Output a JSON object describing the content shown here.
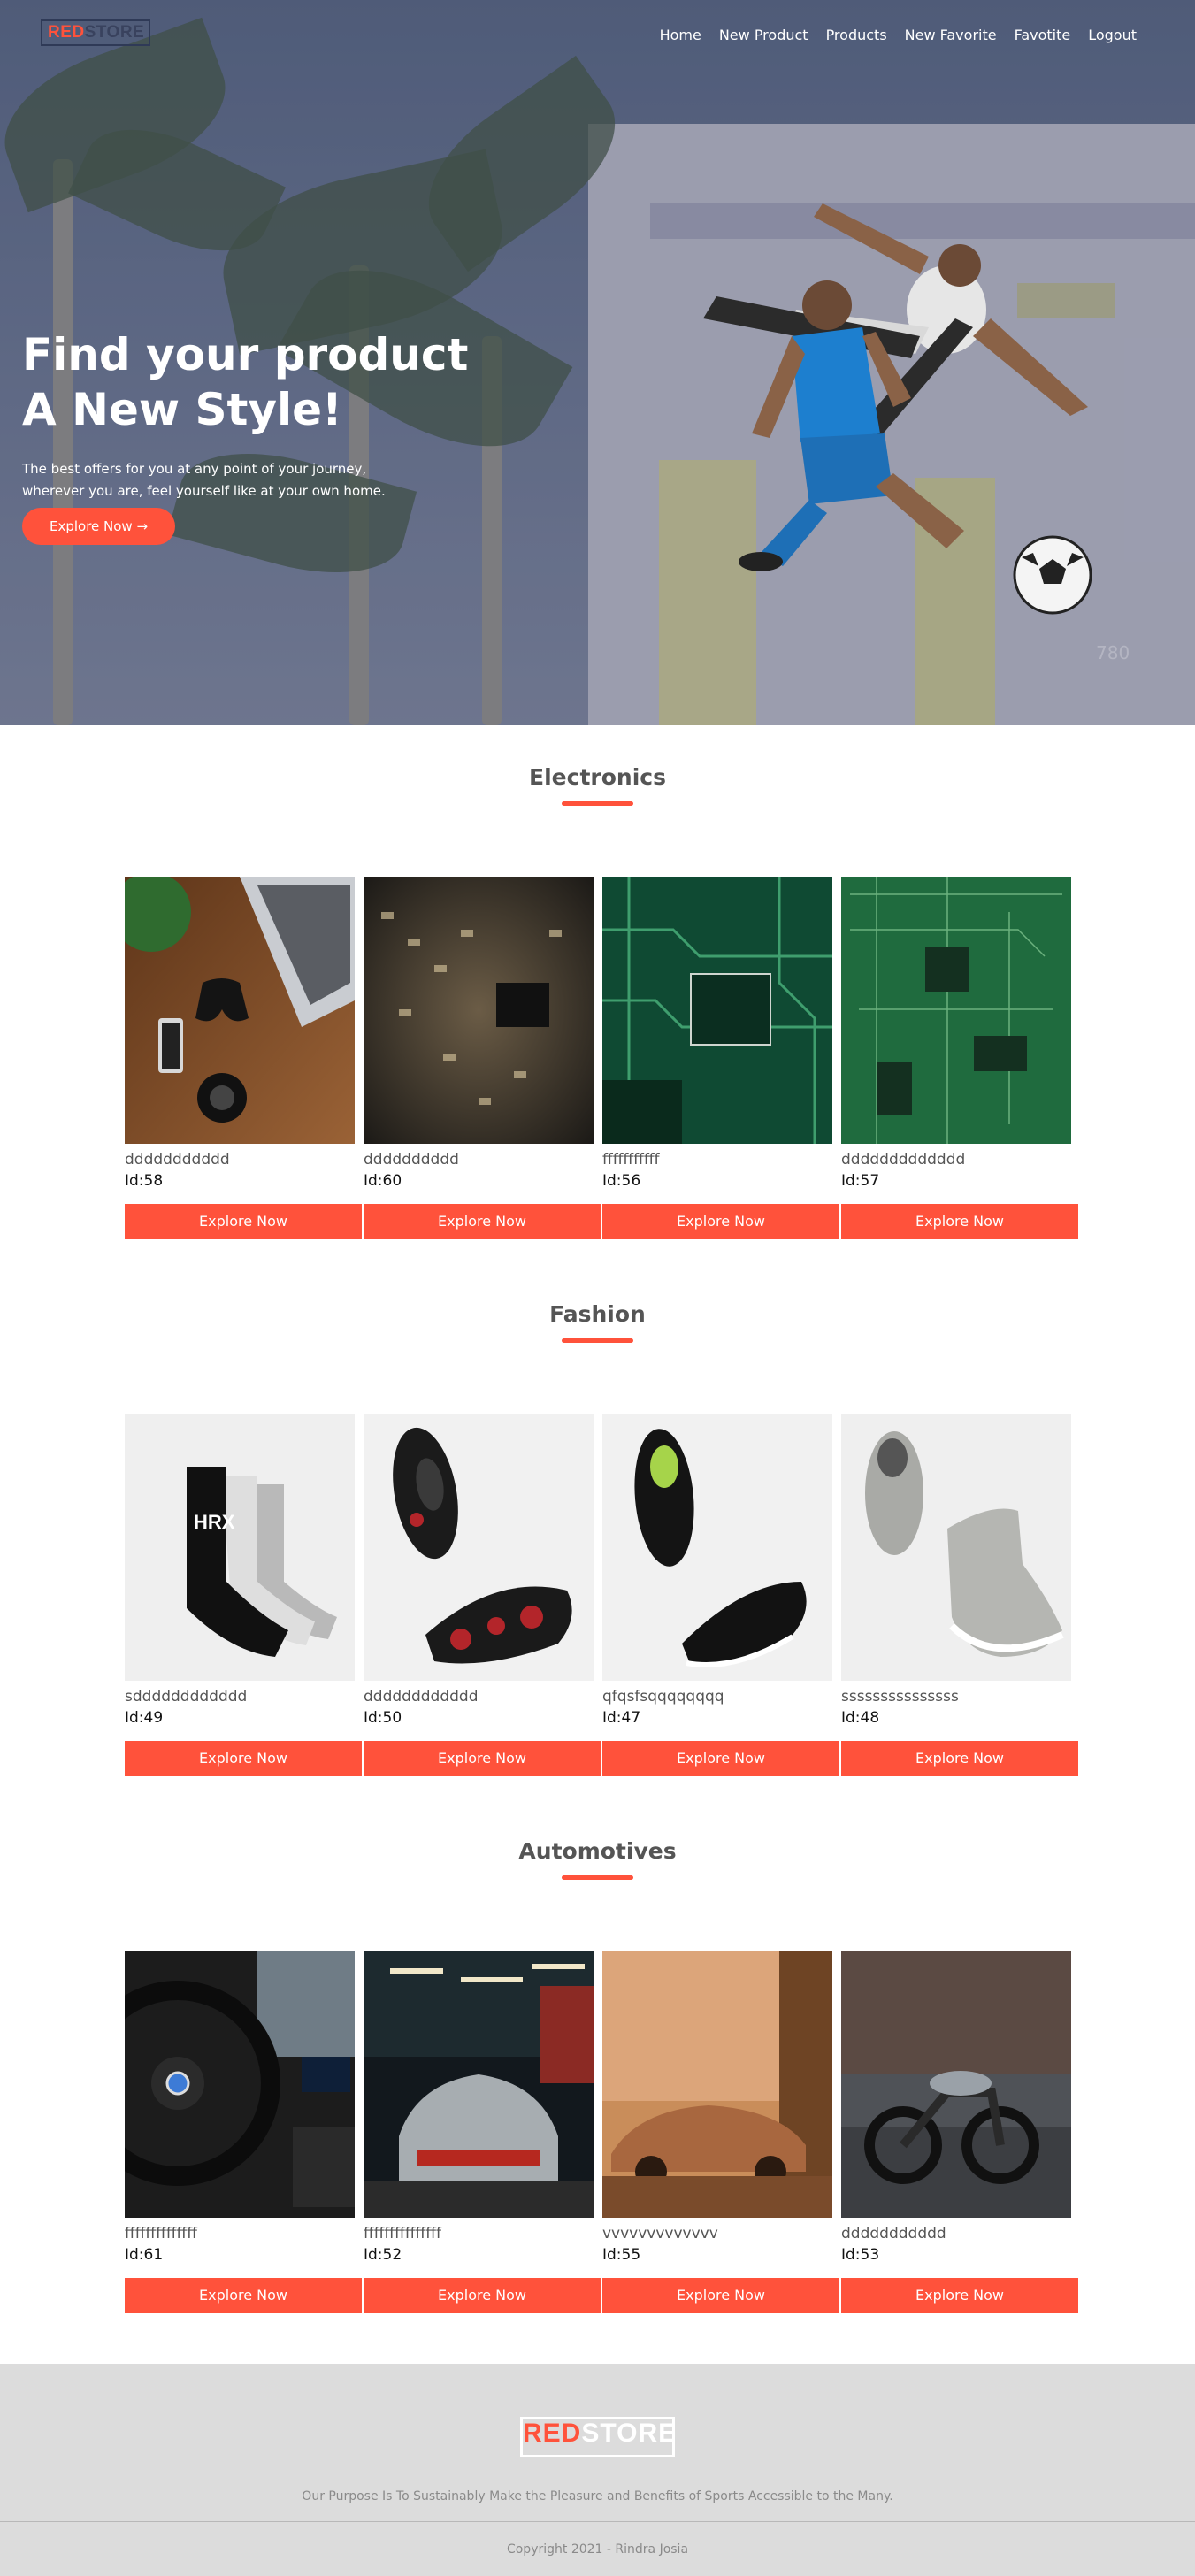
{
  "brand": {
    "red": "RED",
    "rest": "STORE",
    "tagline": ""
  },
  "nav": [
    {
      "label": "Home"
    },
    {
      "label": "New Product"
    },
    {
      "label": "Products"
    },
    {
      "label": "New Favorite"
    },
    {
      "label": "Favotite"
    },
    {
      "label": "Logout"
    }
  ],
  "hero": {
    "title_line1": "Find your product",
    "title_line2": "A New Style!",
    "desc_line1": "The best offers for you at any point of your journey,",
    "desc_line2": "wherever you are, feel yourself like at your own home.",
    "button": "Explore Now →",
    "watermark": "780"
  },
  "sections": [
    {
      "title": "Electronics",
      "products": [
        {
          "name": "ddddddddddd",
          "id": "Id:58",
          "button": "Explore Now",
          "image": "controller-laptop-desk-image"
        },
        {
          "name": "dddddddddd",
          "id": "Id:60",
          "button": "Explore Now",
          "image": "circuit-chip-closeup-image"
        },
        {
          "name": "fffffffffff",
          "id": "Id:56",
          "button": "Explore Now",
          "image": "green-circuit-board-image"
        },
        {
          "name": "ddddddddddddd",
          "id": "Id:57",
          "button": "Explore Now",
          "image": "motherboard-image"
        }
      ]
    },
    {
      "title": "Fashion",
      "products": [
        {
          "name": "sdddddddddddd",
          "id": "Id:49",
          "button": "Explore Now",
          "image": "socks-image"
        },
        {
          "name": "dddddddddddd",
          "id": "Id:50",
          "button": "Explore Now",
          "image": "red-black-sneakers-image"
        },
        {
          "name": "qfqsfsqqqqqqqq",
          "id": "Id:47",
          "button": "Explore Now",
          "image": "black-sneakers-image"
        },
        {
          "name": "sssssssssssssss",
          "id": "Id:48",
          "button": "Explore Now",
          "image": "grey-high-tops-image"
        }
      ]
    },
    {
      "title": "Automotives",
      "products": [
        {
          "name": "ffffffffffffff",
          "id": "Id:61",
          "button": "Explore Now",
          "image": "bmw-interior-image"
        },
        {
          "name": "fffffffffffffff",
          "id": "Id:52",
          "button": "Explore Now",
          "image": "mini-cooper-image"
        },
        {
          "name": "vvvvvvvvvvvvv",
          "id": "Id:55",
          "button": "Explore Now",
          "image": "sports-car-image"
        },
        {
          "name": "ddddddddddd",
          "id": "Id:53",
          "button": "Explore Now",
          "image": "motorcycle-image"
        }
      ]
    }
  ],
  "footer": {
    "purpose": "Our Purpose Is To Sustainably Make the Pleasure and Benefits of Sports Accessible to the Many.",
    "copyright": "Copyright 2021 - Rindra Josia"
  },
  "colors": {
    "accent": "#ff523b",
    "footer_bg": "#dcdcdc",
    "heading": "#555555"
  }
}
